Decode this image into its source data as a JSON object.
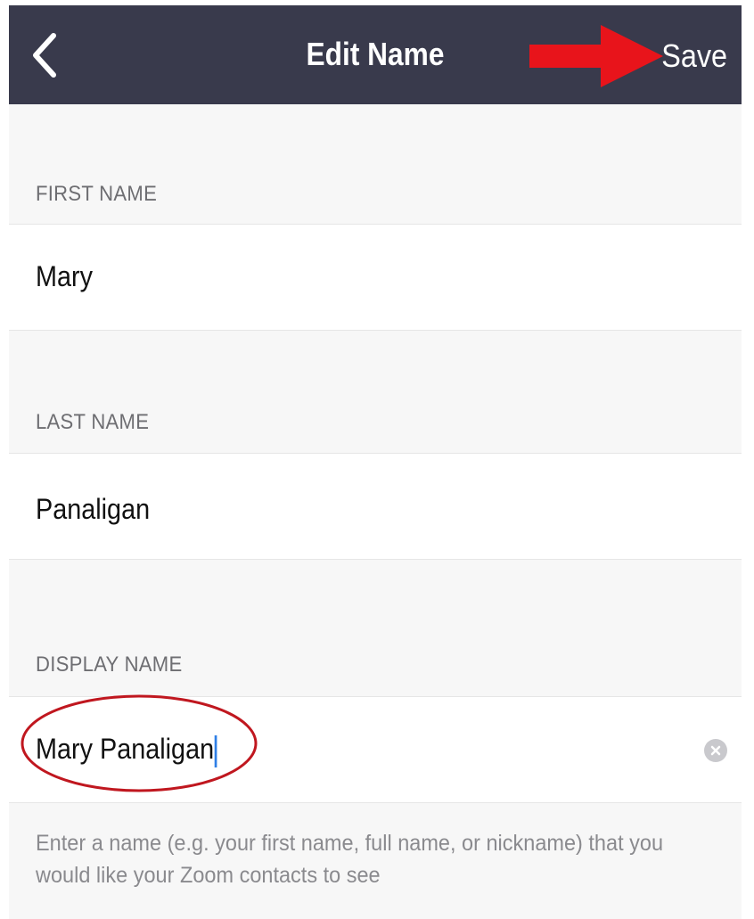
{
  "nav": {
    "title": "Edit Name",
    "save_label": "Save",
    "background_color": "#393a4c",
    "back_icon": "chevron-left-icon"
  },
  "annotation": {
    "arrow_color": "#e8141b",
    "circle_color": "#c0171f"
  },
  "first_name": {
    "label": "FIRST NAME",
    "value": "Mary"
  },
  "last_name": {
    "label": "LAST NAME",
    "value": "Panaligan"
  },
  "display_name": {
    "label": "DISPLAY NAME",
    "value": "Mary Panaligan",
    "clear_icon": "clear-icon",
    "hint": "Enter a name (e.g. your first name, full name, or nickname) that you would like your Zoom contacts to see"
  }
}
